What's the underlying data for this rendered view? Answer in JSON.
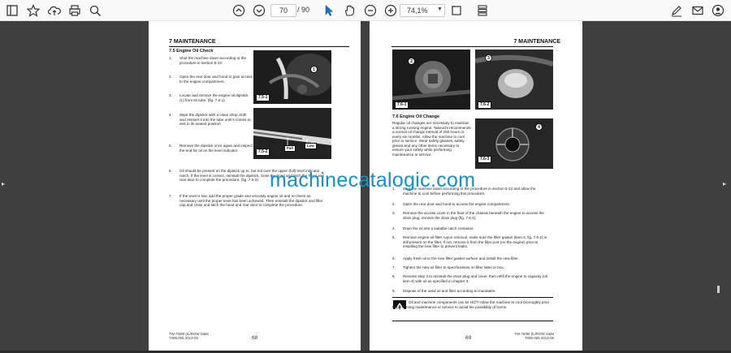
{
  "toolbar": {
    "page_current": "70",
    "page_total": "/ 90",
    "zoom": "74,1%"
  },
  "left_page": {
    "chapter": "7 MAINTENANCE",
    "section": "7.5 Engine Oil Check",
    "items": [
      {
        "n": "1.",
        "text": "Shut the machine down according to the procedure in section 5-13."
      },
      {
        "n": "2.",
        "text": "Open the rear door and hood to gain access to the engine compartment."
      },
      {
        "n": "3.",
        "text": "Locate and remove the engine oil dipstick (1) from its tube. (fig. 7.5-1)"
      },
      {
        "n": "4.",
        "text": "Wipe the dipstick with a clean shop cloth and reinsert it into the tube until it comes to rest in its seated position."
      },
      {
        "n": "5.",
        "text": "Remove the dipstick once again and inspect the end for oil on the level indicator."
      },
      {
        "n": "6.",
        "text": "Oil should be present on the dipstick up to, but not over the upper (full) level indicator notch. If the level is correct, reinstall the dipstick, close the hood and latch the hood and rear door to complete the procedure. (fig. 7.5-2)"
      },
      {
        "n": "7.",
        "text": "If the level is low, add the proper grade and viscosity engine oil and re-check as necessary until the proper level has been achieved. Then reinstall the dipstick and filler cap and close and latch the hood and rear door to complete the procedure."
      }
    ],
    "fig1": "7.5-1",
    "fig1_callout": "1",
    "fig2": "7.5-2",
    "fig2_full": "Full",
    "fig2_low": "Low",
    "footer_model": "TW-70/80 (IL/ROW O&M",
    "footer_code": "7005-065   2013-06",
    "page_number": "68"
  },
  "right_page": {
    "chapter": "7 MAINTENANCE",
    "section": "7.6 Engine Oil Change",
    "intro": "Regular oil changes are necessary to maintain a strong running engine. Takeuchi recommends a normal oil change interval of 250 hours or every six months. Allow the machine to cool prior to service. Wear safety glasses, safety gloves and any other items necessary to ensure your safety while performing maintenance or service.",
    "items": [
      {
        "n": "1.",
        "text": "Shut the machine down according to the procedure in section 5-13 and allow the machine to cool before performing this procedure."
      },
      {
        "n": "2.",
        "text": "Open the rear door and hood to access the engine compartment."
      },
      {
        "n": "3.",
        "text": "Remove the access cover in the floor of the chassis beneath the engine to access the drain plug, remove the drain plug (fig. 7.6-1)."
      },
      {
        "n": "4.",
        "text": "Drain the oil into a suitable catch container."
      },
      {
        "n": "5.",
        "text": "Remove engine oil filter. Upon removal, make sure the filter gasket (item 3, fig. 7.6-2) in still present on the filter. If not, remove it from the filter port (on the engine) prior to installing the new filter to prevent leaks."
      },
      {
        "n": "6.",
        "text": "Apply fresh oil to the new filter gasket surface and install the new filter."
      },
      {
        "n": "7.",
        "text": "Tighten the new oil filter to specifications on filter label or box."
      },
      {
        "n": "8.",
        "text": "Reverse step 3 to reinstall the drain plug and cover, then refill the engine to capacity (oil item 4) with oil as specified in chapter 3."
      },
      {
        "n": "9.",
        "text": "Dispose of the used oil and filter according to mandates."
      }
    ],
    "fig1": "7.6-1",
    "fig1_callout": "2",
    "fig2": "7.6-2",
    "fig2_callout": "3",
    "fig3": "7.6-3",
    "fig3_callout": "4",
    "warning": "Oil and machine components can be HOT! Allow the machine to cool thoroughly prior to performing maintenance or service to avoid the possibility of burns.",
    "footer_model": "TW-70/80 (IL/ROW O&M",
    "footer_code": "7005-065   2013-06",
    "page_number": "69"
  },
  "watermark": "machinecatalogic.com",
  "colors": {
    "watermark": "#1690c6",
    "viewer_bg": "#404040",
    "toolbar_bg": "#f9f9fa"
  }
}
